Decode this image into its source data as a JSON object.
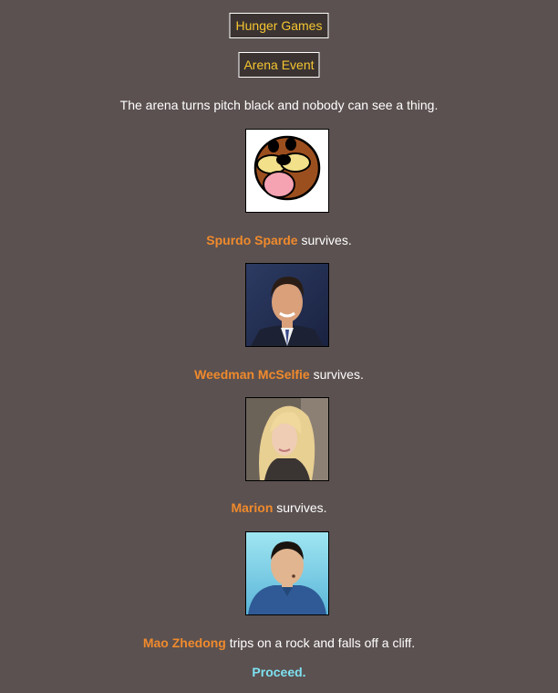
{
  "header": {
    "title": "Hunger Games",
    "event": "Arena Event"
  },
  "intro": "The arena turns pitch black and nobody can see a thing.",
  "entries": [
    {
      "name": "Spurdo Sparde",
      "result": " survives.",
      "portrait": "spurdo-cartoon-bear"
    },
    {
      "name": "Weedman McSelfie",
      "result": " survives.",
      "portrait": "man-in-suit"
    },
    {
      "name": "Marion",
      "result": " survives.",
      "portrait": "blonde-woman"
    },
    {
      "name": "Mao Zhedong",
      "result": " trips on a rock and falls off a cliff.",
      "portrait": "man-blue-jacket"
    }
  ],
  "proceed": {
    "link": "Proceed",
    "suffix": "."
  },
  "colors": {
    "background": "#5b5150",
    "name": "#f08a2c",
    "header_text": "#f5c530",
    "proceed": "#7ee0f0"
  }
}
